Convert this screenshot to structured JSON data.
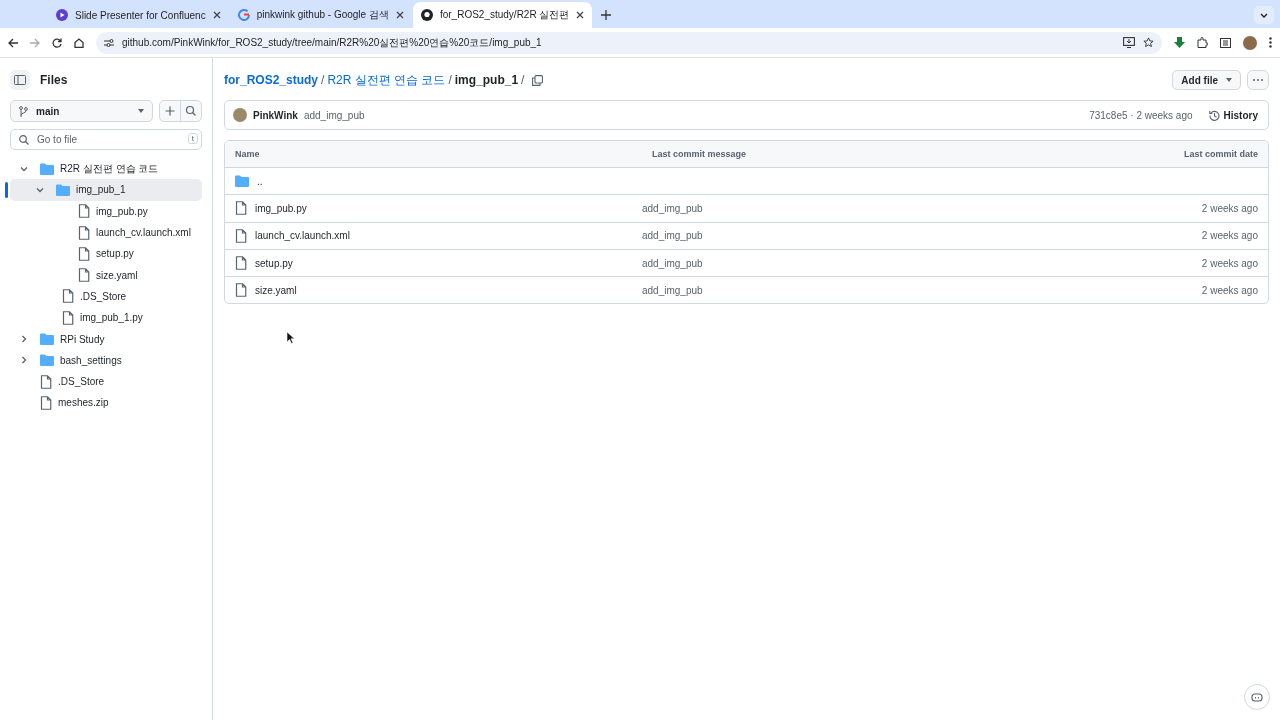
{
  "browser": {
    "tabs": [
      {
        "title": "Slide Presenter for Confluenc",
        "selected": false
      },
      {
        "title": "pinkwink github - Google 검색",
        "selected": false
      },
      {
        "title": "for_ROS2_study/R2R 실전편",
        "selected": true
      }
    ],
    "url": "github.com/PinkWink/for_ROS2_study/tree/main/R2R%20실전편%20연습%20코드/img_pub_1"
  },
  "sidebar": {
    "title": "Files",
    "branch": "main",
    "search": {
      "placeholder": "Go to file",
      "shortcut": "t"
    },
    "tree": [
      {
        "kind": "folder",
        "name": "R2R 실전편 연습 코드",
        "expanded": true,
        "selected": false,
        "children": [
          {
            "kind": "folder",
            "name": "img_pub_1",
            "expanded": true,
            "selected": true,
            "children": [
              {
                "kind": "file",
                "name": "img_pub.py",
                "selected": false
              },
              {
                "kind": "file",
                "name": "launch_cv.launch.xml",
                "selected": false
              },
              {
                "kind": "file",
                "name": "setup.py",
                "selected": false
              },
              {
                "kind": "file",
                "name": "size.yaml",
                "selected": false
              }
            ]
          },
          {
            "kind": "file",
            "name": ".DS_Store",
            "selected": false
          },
          {
            "kind": "file",
            "name": "img_pub_1.py",
            "selected": false
          }
        ]
      },
      {
        "kind": "folder",
        "name": "RPi Study",
        "expanded": false,
        "selected": false
      },
      {
        "kind": "folder",
        "name": "bash_settings",
        "expanded": false,
        "selected": false
      },
      {
        "kind": "file",
        "name": ".DS_Store",
        "selected": false
      },
      {
        "kind": "file",
        "name": "meshes.zip",
        "selected": false
      }
    ]
  },
  "breadcrumb": [
    {
      "kind": "repo",
      "label": "for_ROS2_study"
    },
    {
      "kind": "sep",
      "label": "/"
    },
    {
      "kind": "link",
      "label": "R2R 실전편 연습 코드"
    },
    {
      "kind": "sep",
      "label": "/"
    },
    {
      "kind": "current",
      "label": "img_pub_1"
    },
    {
      "kind": "sep",
      "label": "/"
    }
  ],
  "add_file": "Add file",
  "commit": {
    "author": "PinkWink",
    "message": "add_img_pub",
    "meta": "731c8e5 · 2 weeks ago",
    "history": "History"
  },
  "table": {
    "columns": [
      "Name",
      "Last commit message",
      "Last commit date"
    ],
    "rows": [
      {
        "kind": "parent",
        "name": ".."
      },
      {
        "kind": "file",
        "name": "img_pub.py",
        "message": "add_img_pub",
        "date": "2 weeks ago"
      },
      {
        "kind": "file",
        "name": "launch_cv.launch.xml",
        "message": "add_img_pub",
        "date": "2 weeks ago"
      },
      {
        "kind": "file",
        "name": "setup.py",
        "message": "add_img_pub",
        "date": "2 weeks ago"
      },
      {
        "kind": "file",
        "name": "size.yaml",
        "message": "add_img_pub",
        "date": "2 weeks ago"
      }
    ]
  }
}
